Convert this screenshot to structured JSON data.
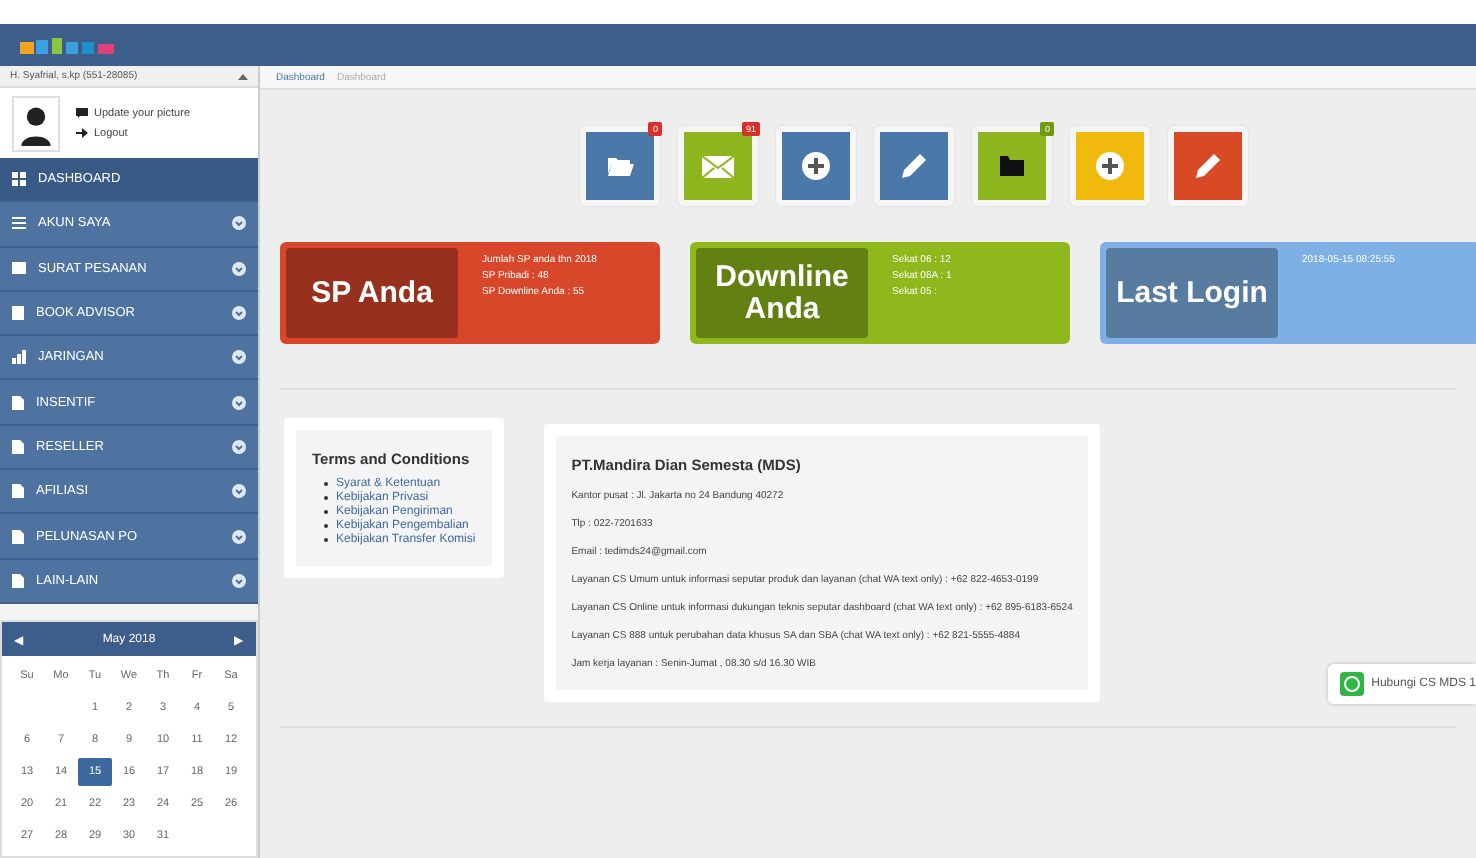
{
  "header": {
    "user": "H. Syafrial, s.kp (551-28085)"
  },
  "profile": {
    "links": [
      {
        "kind": "comment",
        "label": "Update your picture"
      },
      {
        "kind": "logout",
        "label": "Logout"
      }
    ]
  },
  "menu": [
    {
      "label": "DASHBOARD",
      "kind": "grid",
      "selected": true,
      "expandable": false
    },
    {
      "label": "AKUN SAYA",
      "kind": "list",
      "selected": false,
      "expandable": true
    },
    {
      "label": "SURAT PESANAN",
      "kind": "envelope",
      "selected": false,
      "expandable": true
    },
    {
      "label": "BOOK ADVISOR",
      "kind": "book",
      "selected": false,
      "expandable": true
    },
    {
      "label": "JARINGAN",
      "kind": "chart",
      "selected": false,
      "expandable": true
    },
    {
      "label": "INSENTIF",
      "kind": "file",
      "selected": false,
      "expandable": true
    },
    {
      "label": "RESELLER",
      "kind": "file",
      "selected": false,
      "expandable": true
    },
    {
      "label": "AFILIASI",
      "kind": "file",
      "selected": false,
      "expandable": true
    },
    {
      "label": "PELUNASAN PO",
      "kind": "file",
      "selected": false,
      "expandable": true
    },
    {
      "label": "LAIN-LAIN",
      "kind": "file",
      "selected": false,
      "expandable": true
    }
  ],
  "calendar": {
    "month": "May 2018",
    "prev": "◀",
    "next": "▶",
    "weekdays": [
      "Su",
      "Mo",
      "Tu",
      "We",
      "Th",
      "Fr",
      "Sa"
    ],
    "weeks": [
      {
        "kind": "first",
        "days": [
          {
            "day": "1",
            "selected": false
          },
          {
            "day": "2",
            "selected": false
          },
          {
            "day": "3",
            "selected": false
          },
          {
            "day": "4",
            "selected": false
          },
          {
            "day": "5",
            "selected": false
          }
        ]
      },
      {
        "kind": "full",
        "days": [
          {
            "day": "6",
            "selected": false
          },
          {
            "day": "7",
            "selected": false
          },
          {
            "day": "8",
            "selected": false
          },
          {
            "day": "9",
            "selected": false
          },
          {
            "day": "10",
            "selected": false
          },
          {
            "day": "11",
            "selected": false
          },
          {
            "day": "12",
            "selected": false
          }
        ]
      },
      {
        "kind": "full",
        "days": [
          {
            "day": "13",
            "selected": false
          },
          {
            "day": "14",
            "selected": false
          },
          {
            "day": "15",
            "selected": true
          },
          {
            "day": "16",
            "selected": false
          },
          {
            "day": "17",
            "selected": false
          },
          {
            "day": "18",
            "selected": false
          },
          {
            "day": "19",
            "selected": false
          }
        ]
      },
      {
        "kind": "full",
        "days": [
          {
            "day": "20",
            "selected": false
          },
          {
            "day": "21",
            "selected": false
          },
          {
            "day": "22",
            "selected": false
          },
          {
            "day": "23",
            "selected": false
          },
          {
            "day": "24",
            "selected": false
          },
          {
            "day": "25",
            "selected": false
          },
          {
            "day": "26",
            "selected": false
          }
        ]
      },
      {
        "kind": "last",
        "days": [
          {
            "day": "27",
            "selected": false
          },
          {
            "day": "28",
            "selected": false
          },
          {
            "day": "29",
            "selected": false
          },
          {
            "day": "30",
            "selected": false
          },
          {
            "day": "31",
            "selected": false
          }
        ]
      }
    ]
  },
  "breadcrumb": [
    "Dashboard",
    "Dashboard"
  ],
  "shortcuts": [
    {
      "kind": "folder-open",
      "color": "#4a78a8",
      "badge": "0"
    },
    {
      "kind": "envelope",
      "color": "#8db51e",
      "badge": "91"
    },
    {
      "kind": "plus",
      "color": "#4a78a8"
    },
    {
      "kind": "pencil",
      "color": "#4a78a8"
    },
    {
      "kind": "folder-dark",
      "color": "#8db51e",
      "badge": "0"
    },
    {
      "kind": "plus",
      "color": "#f2b90d"
    },
    {
      "kind": "pencil",
      "color": "#d84a24"
    }
  ],
  "stats": [
    {
      "title": "SP Anda",
      "color": "#d9472a",
      "lines": [
        "Jumlah SP anda thn 2018",
        "SP Pribadi : 48",
        "SP Downline Anda : 55"
      ]
    },
    {
      "title": "Downline Anda",
      "color": "#8fb81c",
      "lines": [
        "Sekat 06 : 12",
        "Sekat 08A : 1",
        "Sekat 05 :"
      ]
    },
    {
      "title": "Last Login",
      "color": "#7eb0e6",
      "lines": [
        "2018-05-15 08:25:55"
      ]
    }
  ],
  "terms": {
    "title": "Terms and Conditions",
    "links": [
      "Syarat & Ketentuan",
      "Kebijakan Privasi",
      "Kebijakan Pengiriman",
      "Kebijakan Pengembalian",
      "Kebijakan Transfer Komisi"
    ]
  },
  "company": {
    "name": "PT.Mandira Dian Semesta (MDS)",
    "lines": [
      "Kantor pusat : Jl. Jakarta no 24 Bandung 40272",
      "Tlp : 022-7201633",
      "Email : tedimds24@gmail.com",
      "Layanan CS Umum untuk informasi seputar produk dan layanan (chat WA text only) : +62 822-4653-0199",
      "Layanan CS Online untuk informasi dukungan teknis seputar dashboard (chat WA text only) : +62 895-6183-6524",
      "Layanan CS 888 untuk perubahan data khusus SA dan SBA (chat WA text only) : +62 821-5555-4884",
      "Jam kerja layanan : Senin-Jumat , 08.30 s/d 16.30 WIB"
    ]
  },
  "whatsapp": {
    "label": "Hubungi CS MDS 1"
  }
}
